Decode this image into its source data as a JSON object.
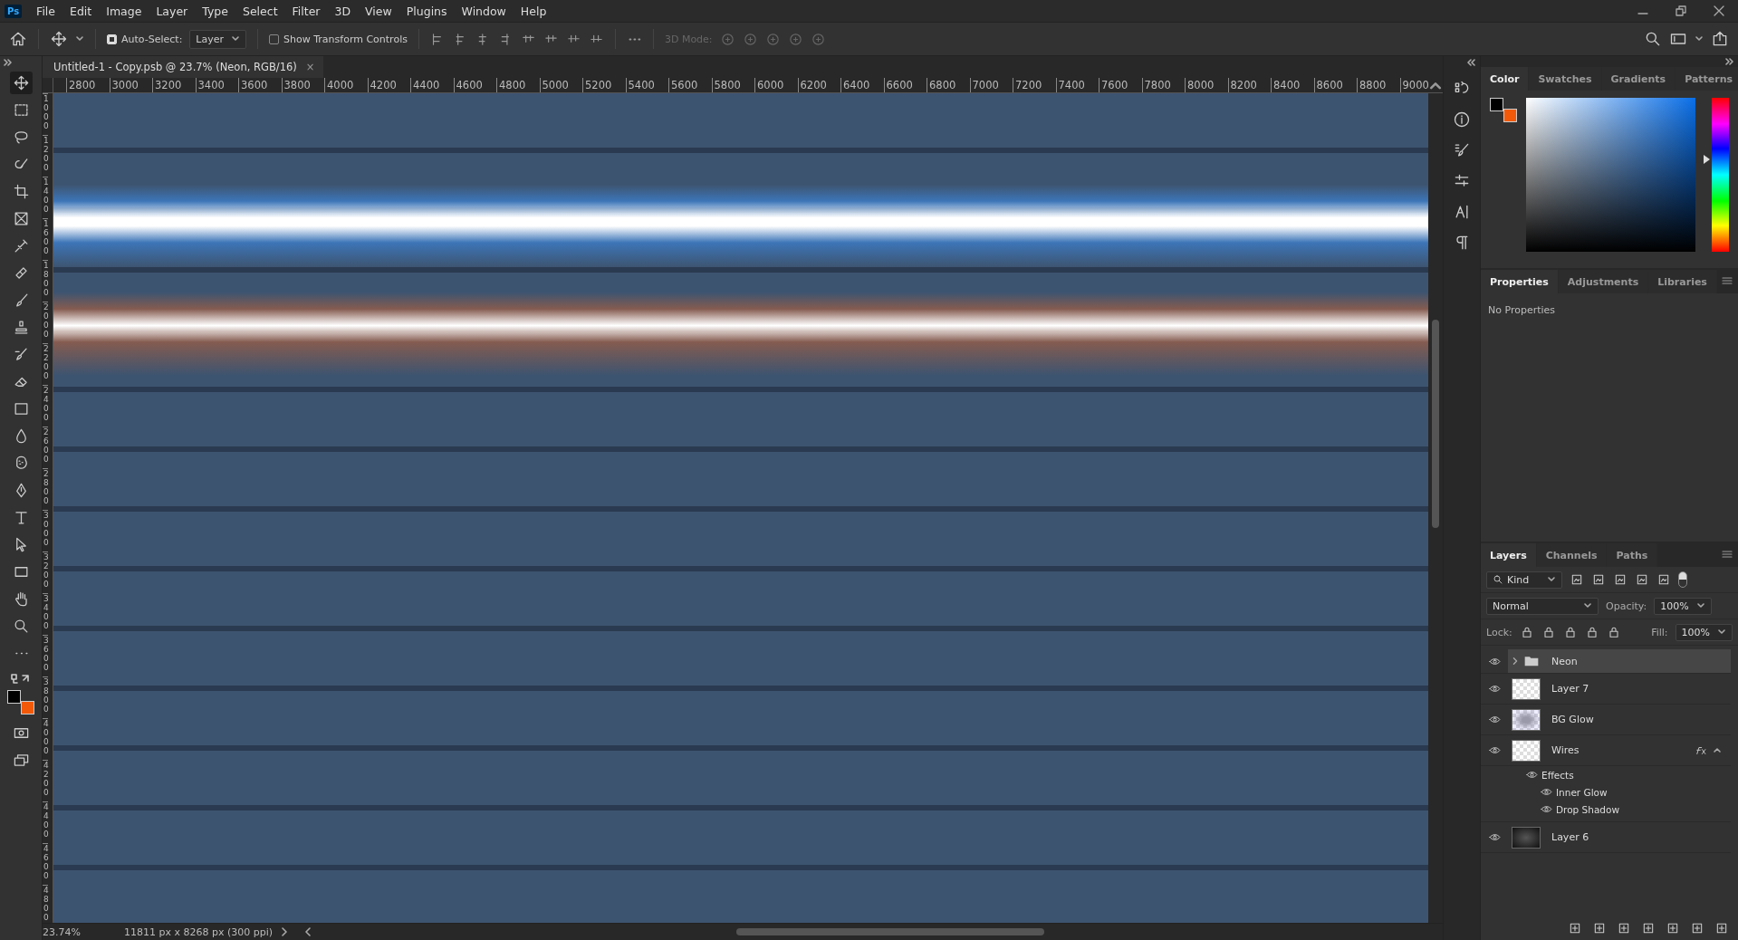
{
  "app": {
    "logo": "Ps",
    "menu": [
      "File",
      "Edit",
      "Image",
      "Layer",
      "Type",
      "Select",
      "Filter",
      "3D",
      "View",
      "Plugins",
      "Window",
      "Help"
    ]
  },
  "options_bar": {
    "auto_select": {
      "label": "Auto-Select:",
      "checked": true
    },
    "target": "Layer",
    "transform_controls": {
      "label": "Show Transform Controls",
      "checked": false
    },
    "mode_label": "3D Mode:"
  },
  "document_tab": {
    "title": "Untitled-1 - Copy.psb @ 23.7% (Neon, RGB/16)",
    "close": "×"
  },
  "rulers": {
    "horizontal": [
      "2800",
      "3000",
      "3200",
      "3400",
      "3600",
      "3800",
      "4000",
      "4200",
      "4400",
      "4600",
      "4800",
      "5000",
      "5200",
      "5400",
      "5600",
      "5800",
      "6000",
      "6200",
      "6400",
      "6600",
      "6800",
      "7000",
      "7200",
      "7400",
      "7600",
      "7800",
      "8000",
      "8200",
      "8400",
      "8600",
      "8800",
      "9000"
    ],
    "vertical": [
      "1000",
      "1200",
      "1400",
      "1600",
      "1800",
      "2000",
      "2200",
      "2400",
      "2600",
      "2800",
      "3000",
      "3200",
      "3400",
      "3600",
      "3800",
      "4000",
      "4200",
      "4400",
      "4600",
      "4800"
    ]
  },
  "status_bar": {
    "zoom": "23.74%",
    "size": "11811 px x 8268 px (300 ppi)"
  },
  "color_panel": {
    "tabs": [
      {
        "label": "Color",
        "selected": true
      },
      {
        "label": "Swatches",
        "selected": false
      },
      {
        "label": "Gradients",
        "selected": false
      },
      {
        "label": "Patterns",
        "selected": false
      }
    ],
    "swatches": [
      {
        "color": "#000000"
      },
      {
        "color": "#f25a0a"
      }
    ],
    "hue": {
      "level": 0.6
    }
  },
  "properties_panel": {
    "tabs": [
      {
        "label": "Properties",
        "selected": true
      },
      {
        "label": "Adjustments",
        "selected": false
      },
      {
        "label": "Libraries",
        "selected": false
      }
    ],
    "message": "No Properties"
  },
  "layers_panel": {
    "tabs": [
      {
        "label": "Layers",
        "selected": true
      },
      {
        "label": "Channels",
        "selected": false
      },
      {
        "label": "Paths",
        "selected": false
      }
    ],
    "filter": "Kind",
    "blend_mode": "Normal",
    "opacity": {
      "label": "Opacity:",
      "value": "100%"
    },
    "lock_label": "Lock:",
    "fill": {
      "label": "Fill:",
      "value": "100%"
    },
    "layers": [
      {
        "name": "Neon",
        "kind": "group",
        "visible": true,
        "selected": true,
        "expanded": false
      },
      {
        "name": "Layer 7",
        "kind": "transparent",
        "visible": true,
        "selected": false
      },
      {
        "name": "BG Glow",
        "kind": "glow",
        "visible": true,
        "selected": false
      },
      {
        "name": "Wires",
        "kind": "transparent",
        "visible": true,
        "selected": false,
        "expanded": true,
        "effects_label": "Effects",
        "effects": [
          {
            "name": "Inner Glow",
            "visible": true
          },
          {
            "name": "Drop Shadow",
            "visible": true
          }
        ]
      },
      {
        "name": "Layer 6",
        "kind": "texture",
        "visible": true,
        "selected": false
      }
    ]
  }
}
